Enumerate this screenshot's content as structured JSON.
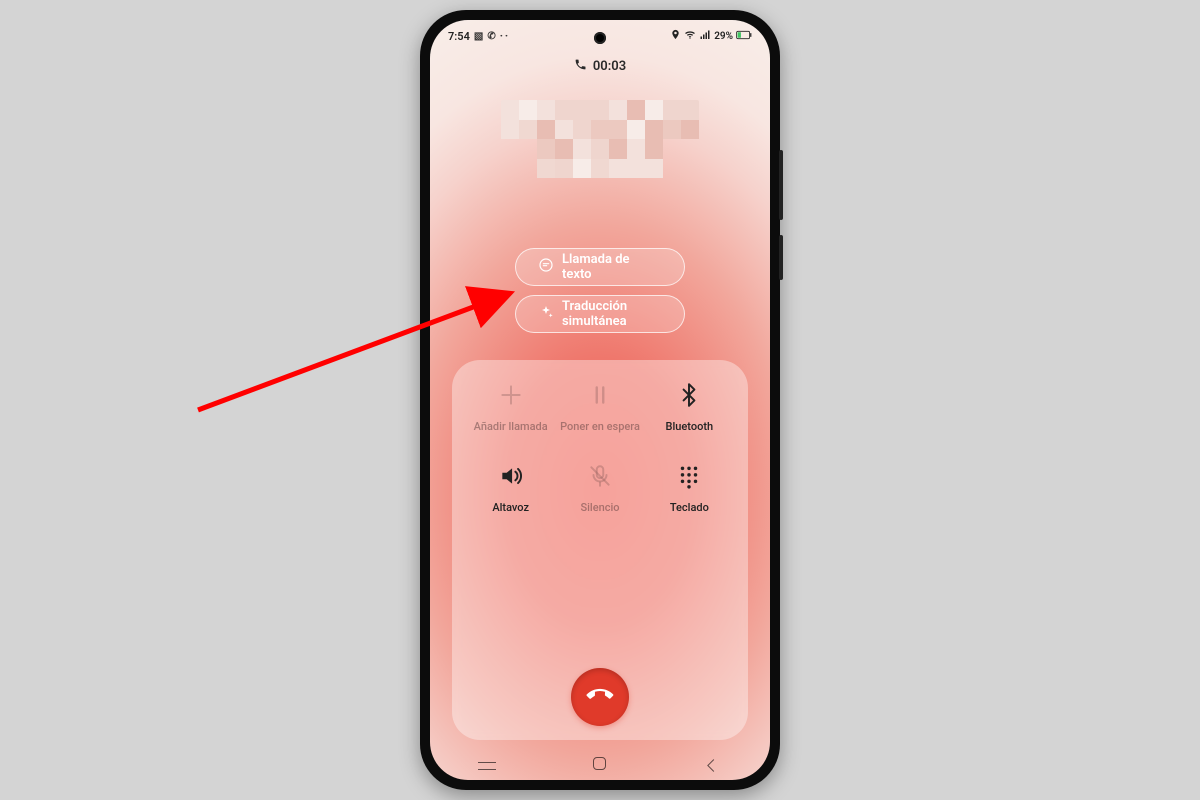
{
  "statusbar": {
    "time": "7:54",
    "battery_text": "29%"
  },
  "call": {
    "duration": "00:03"
  },
  "pills": {
    "text_call": "Llamada de texto",
    "live_translate": "Traducción simultánea"
  },
  "controls": {
    "add_call": "Añadir llamada",
    "hold": "Poner en espera",
    "bluetooth": "Bluetooth",
    "speaker": "Altavoz",
    "mute": "Silencio",
    "keypad": "Teclado"
  },
  "annotation": {
    "arrow_color": "#ff0000",
    "points_to": "live-translate-button"
  }
}
